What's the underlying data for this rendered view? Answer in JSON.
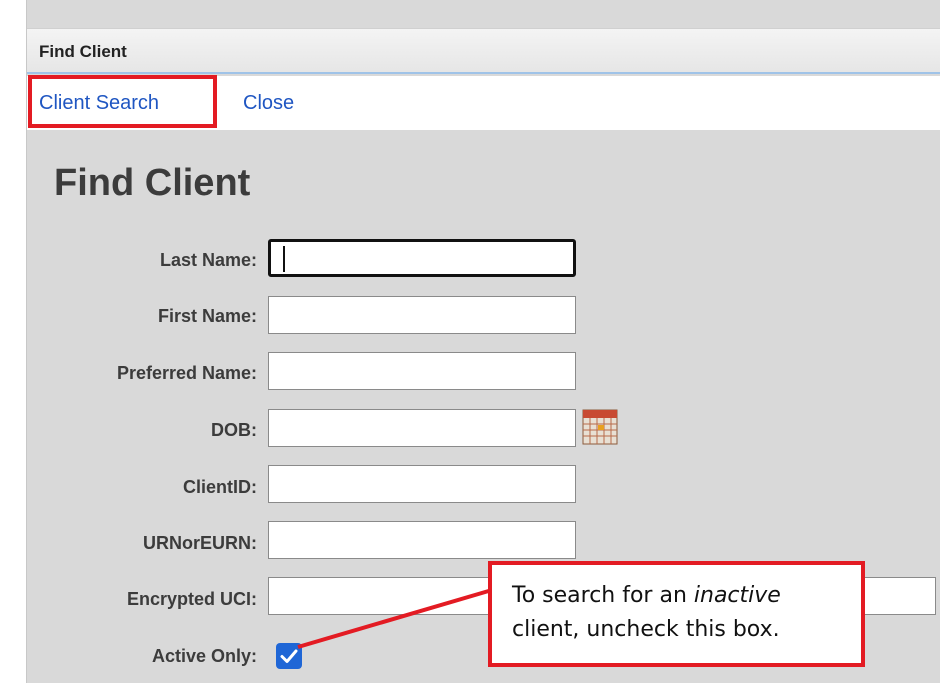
{
  "window": {
    "title": "Find Client"
  },
  "menu": {
    "items": [
      "Client Search",
      "Close"
    ]
  },
  "page": {
    "heading": "Find Client"
  },
  "form": {
    "last_name": {
      "label": "Last Name:",
      "value": ""
    },
    "first_name": {
      "label": "First Name:",
      "value": ""
    },
    "preferred_name": {
      "label": "Preferred Name:",
      "value": ""
    },
    "dob": {
      "label": "DOB:",
      "value": ""
    },
    "client_id": {
      "label": "ClientID:",
      "value": ""
    },
    "urn": {
      "label": "URNorEURN:",
      "value": ""
    },
    "encrypted_uci": {
      "label": "Encrypted UCI:",
      "value": ""
    },
    "active_only": {
      "label": "Active Only:",
      "checked": true
    }
  },
  "callout": {
    "text_before": "To search for an ",
    "text_italic": "inactive",
    "text_after": " client, uncheck this box."
  },
  "colors": {
    "accent": "#e31b23",
    "link": "#1f56c2",
    "checkbox": "#1f66d6"
  },
  "icons": {
    "calendar": "calendar-icon",
    "check": "checkmark-icon"
  }
}
